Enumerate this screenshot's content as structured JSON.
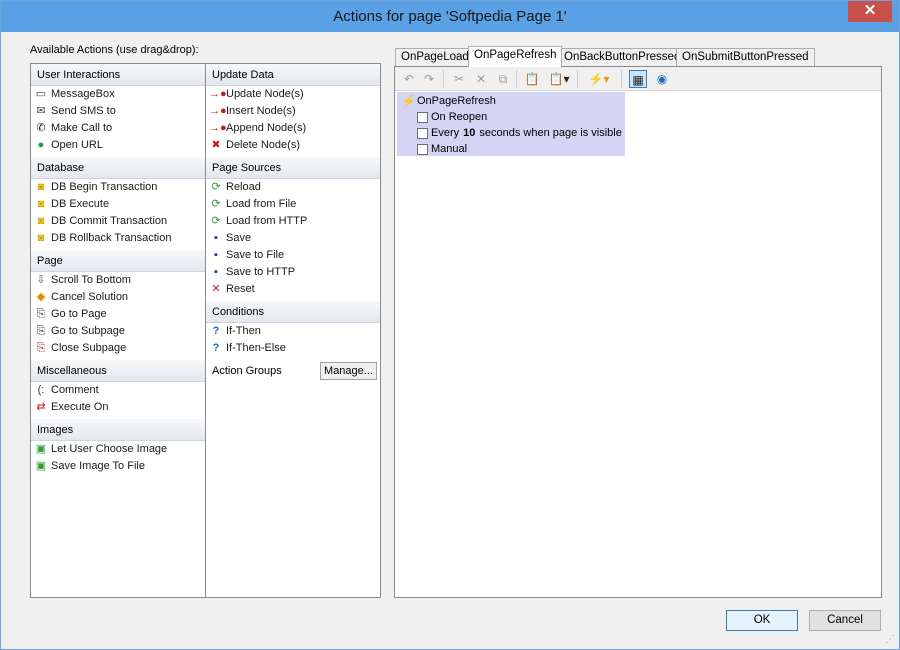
{
  "window": {
    "title": "Actions for page 'Softpedia Page 1'",
    "close_glyph": "✕"
  },
  "available_label": "Available Actions (use drag&drop):",
  "groups": {
    "user_interactions": {
      "title": "User Interactions",
      "items": [
        {
          "label": "MessageBox",
          "icon": "message-icon"
        },
        {
          "label": "Send SMS to",
          "icon": "envelope-icon"
        },
        {
          "label": "Make Call to",
          "icon": "phone-icon"
        },
        {
          "label": "Open URL",
          "icon": "url-icon"
        }
      ]
    },
    "database": {
      "title": "Database",
      "items": [
        {
          "label": "DB Begin Transaction",
          "icon": "db-begin-icon"
        },
        {
          "label": "DB Execute",
          "icon": "db-execute-icon"
        },
        {
          "label": "DB Commit Transaction",
          "icon": "db-commit-icon"
        },
        {
          "label": "DB Rollback Transaction",
          "icon": "db-rollback-icon"
        }
      ]
    },
    "page": {
      "title": "Page",
      "items": [
        {
          "label": "Scroll To Bottom",
          "icon": "scroll-down-icon"
        },
        {
          "label": "Cancel Solution",
          "icon": "cancel-diamond-icon"
        },
        {
          "label": "Go to Page",
          "icon": "go-page-icon"
        },
        {
          "label": "Go to Subpage",
          "icon": "go-subpage-icon"
        },
        {
          "label": "Close Subpage",
          "icon": "close-subpage-icon"
        }
      ]
    },
    "miscellaneous": {
      "title": "Miscellaneous",
      "items": [
        {
          "label": "Comment",
          "icon": "comment-icon"
        },
        {
          "label": "Execute On",
          "icon": "execute-on-icon"
        }
      ]
    },
    "images": {
      "title": "Images",
      "items": [
        {
          "label": "Let User Choose Image",
          "icon": "choose-image-icon"
        },
        {
          "label": "Save Image To File",
          "icon": "save-image-icon"
        }
      ]
    },
    "update_data": {
      "title": "Update Data",
      "items": [
        {
          "label": "Update Node(s)",
          "icon": "update-node-icon"
        },
        {
          "label": "Insert Node(s)",
          "icon": "insert-node-icon"
        },
        {
          "label": "Append Node(s)",
          "icon": "append-node-icon"
        },
        {
          "label": "Delete Node(s)",
          "icon": "delete-node-icon"
        }
      ]
    },
    "page_sources": {
      "title": "Page Sources",
      "items": [
        {
          "label": "Reload",
          "icon": "reload-icon"
        },
        {
          "label": "Load from File",
          "icon": "load-file-icon"
        },
        {
          "label": "Load from HTTP",
          "icon": "load-http-icon"
        },
        {
          "label": "Save",
          "icon": "save-icon"
        },
        {
          "label": "Save to File",
          "icon": "save-file-icon"
        },
        {
          "label": "Save to HTTP",
          "icon": "save-http-icon"
        },
        {
          "label": "Reset",
          "icon": "reset-icon"
        }
      ]
    },
    "conditions": {
      "title": "Conditions",
      "items": [
        {
          "label": "If-Then",
          "icon": "question-icon"
        },
        {
          "label": "If-Then-Else",
          "icon": "question-icon"
        }
      ]
    },
    "action_groups": {
      "title": "Action Groups",
      "manage_label": "Manage..."
    }
  },
  "tabs": [
    {
      "label": "OnPageLoad",
      "active": false
    },
    {
      "label": "OnPageRefresh",
      "active": true
    },
    {
      "label": "OnBackButtonPressed",
      "active": false
    },
    {
      "label": "OnSubmitButtonPressed",
      "active": false
    }
  ],
  "toolbar": [
    "undo-icon",
    "redo-icon",
    "cut-icon",
    "delete-icon",
    "copy-icon",
    "paste-icon",
    "paste-special-icon",
    "event-icon",
    "grid-view-icon",
    "preview-icon"
  ],
  "tree": {
    "root_label": "OnPageRefresh",
    "on_reopen": {
      "label": "On Reopen",
      "checked": false
    },
    "every": {
      "prefix": "Every",
      "value": "10",
      "suffix": "seconds when page is visible",
      "checked": false
    },
    "manual": {
      "label": "Manual",
      "checked": false
    }
  },
  "buttons": {
    "ok": "OK",
    "cancel": "Cancel"
  }
}
